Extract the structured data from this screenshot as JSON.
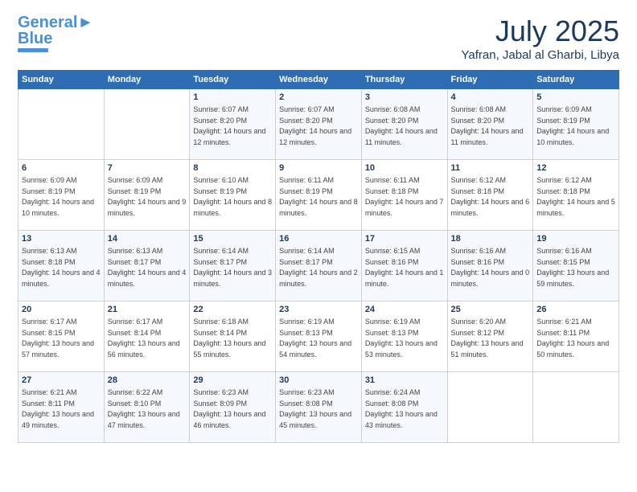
{
  "logo": {
    "line1": "General",
    "line2": "Blue"
  },
  "title": "July 2025",
  "subtitle": "Yafran, Jabal al Gharbi, Libya",
  "days_of_week": [
    "Sunday",
    "Monday",
    "Tuesday",
    "Wednesday",
    "Thursday",
    "Friday",
    "Saturday"
  ],
  "weeks": [
    [
      {
        "num": "",
        "sunrise": "",
        "sunset": "",
        "daylight": ""
      },
      {
        "num": "",
        "sunrise": "",
        "sunset": "",
        "daylight": ""
      },
      {
        "num": "1",
        "sunrise": "Sunrise: 6:07 AM",
        "sunset": "Sunset: 8:20 PM",
        "daylight": "Daylight: 14 hours and 12 minutes."
      },
      {
        "num": "2",
        "sunrise": "Sunrise: 6:07 AM",
        "sunset": "Sunset: 8:20 PM",
        "daylight": "Daylight: 14 hours and 12 minutes."
      },
      {
        "num": "3",
        "sunrise": "Sunrise: 6:08 AM",
        "sunset": "Sunset: 8:20 PM",
        "daylight": "Daylight: 14 hours and 11 minutes."
      },
      {
        "num": "4",
        "sunrise": "Sunrise: 6:08 AM",
        "sunset": "Sunset: 8:20 PM",
        "daylight": "Daylight: 14 hours and 11 minutes."
      },
      {
        "num": "5",
        "sunrise": "Sunrise: 6:09 AM",
        "sunset": "Sunset: 8:19 PM",
        "daylight": "Daylight: 14 hours and 10 minutes."
      }
    ],
    [
      {
        "num": "6",
        "sunrise": "Sunrise: 6:09 AM",
        "sunset": "Sunset: 8:19 PM",
        "daylight": "Daylight: 14 hours and 10 minutes."
      },
      {
        "num": "7",
        "sunrise": "Sunrise: 6:09 AM",
        "sunset": "Sunset: 8:19 PM",
        "daylight": "Daylight: 14 hours and 9 minutes."
      },
      {
        "num": "8",
        "sunrise": "Sunrise: 6:10 AM",
        "sunset": "Sunset: 8:19 PM",
        "daylight": "Daylight: 14 hours and 8 minutes."
      },
      {
        "num": "9",
        "sunrise": "Sunrise: 6:11 AM",
        "sunset": "Sunset: 8:19 PM",
        "daylight": "Daylight: 14 hours and 8 minutes."
      },
      {
        "num": "10",
        "sunrise": "Sunrise: 6:11 AM",
        "sunset": "Sunset: 8:18 PM",
        "daylight": "Daylight: 14 hours and 7 minutes."
      },
      {
        "num": "11",
        "sunrise": "Sunrise: 6:12 AM",
        "sunset": "Sunset: 8:18 PM",
        "daylight": "Daylight: 14 hours and 6 minutes."
      },
      {
        "num": "12",
        "sunrise": "Sunrise: 6:12 AM",
        "sunset": "Sunset: 8:18 PM",
        "daylight": "Daylight: 14 hours and 5 minutes."
      }
    ],
    [
      {
        "num": "13",
        "sunrise": "Sunrise: 6:13 AM",
        "sunset": "Sunset: 8:18 PM",
        "daylight": "Daylight: 14 hours and 4 minutes."
      },
      {
        "num": "14",
        "sunrise": "Sunrise: 6:13 AM",
        "sunset": "Sunset: 8:17 PM",
        "daylight": "Daylight: 14 hours and 4 minutes."
      },
      {
        "num": "15",
        "sunrise": "Sunrise: 6:14 AM",
        "sunset": "Sunset: 8:17 PM",
        "daylight": "Daylight: 14 hours and 3 minutes."
      },
      {
        "num": "16",
        "sunrise": "Sunrise: 6:14 AM",
        "sunset": "Sunset: 8:17 PM",
        "daylight": "Daylight: 14 hours and 2 minutes."
      },
      {
        "num": "17",
        "sunrise": "Sunrise: 6:15 AM",
        "sunset": "Sunset: 8:16 PM",
        "daylight": "Daylight: 14 hours and 1 minute."
      },
      {
        "num": "18",
        "sunrise": "Sunrise: 6:16 AM",
        "sunset": "Sunset: 8:16 PM",
        "daylight": "Daylight: 14 hours and 0 minutes."
      },
      {
        "num": "19",
        "sunrise": "Sunrise: 6:16 AM",
        "sunset": "Sunset: 8:15 PM",
        "daylight": "Daylight: 13 hours and 59 minutes."
      }
    ],
    [
      {
        "num": "20",
        "sunrise": "Sunrise: 6:17 AM",
        "sunset": "Sunset: 8:15 PM",
        "daylight": "Daylight: 13 hours and 57 minutes."
      },
      {
        "num": "21",
        "sunrise": "Sunrise: 6:17 AM",
        "sunset": "Sunset: 8:14 PM",
        "daylight": "Daylight: 13 hours and 56 minutes."
      },
      {
        "num": "22",
        "sunrise": "Sunrise: 6:18 AM",
        "sunset": "Sunset: 8:14 PM",
        "daylight": "Daylight: 13 hours and 55 minutes."
      },
      {
        "num": "23",
        "sunrise": "Sunrise: 6:19 AM",
        "sunset": "Sunset: 8:13 PM",
        "daylight": "Daylight: 13 hours and 54 minutes."
      },
      {
        "num": "24",
        "sunrise": "Sunrise: 6:19 AM",
        "sunset": "Sunset: 8:13 PM",
        "daylight": "Daylight: 13 hours and 53 minutes."
      },
      {
        "num": "25",
        "sunrise": "Sunrise: 6:20 AM",
        "sunset": "Sunset: 8:12 PM",
        "daylight": "Daylight: 13 hours and 51 minutes."
      },
      {
        "num": "26",
        "sunrise": "Sunrise: 6:21 AM",
        "sunset": "Sunset: 8:11 PM",
        "daylight": "Daylight: 13 hours and 50 minutes."
      }
    ],
    [
      {
        "num": "27",
        "sunrise": "Sunrise: 6:21 AM",
        "sunset": "Sunset: 8:11 PM",
        "daylight": "Daylight: 13 hours and 49 minutes."
      },
      {
        "num": "28",
        "sunrise": "Sunrise: 6:22 AM",
        "sunset": "Sunset: 8:10 PM",
        "daylight": "Daylight: 13 hours and 47 minutes."
      },
      {
        "num": "29",
        "sunrise": "Sunrise: 6:23 AM",
        "sunset": "Sunset: 8:09 PM",
        "daylight": "Daylight: 13 hours and 46 minutes."
      },
      {
        "num": "30",
        "sunrise": "Sunrise: 6:23 AM",
        "sunset": "Sunset: 8:08 PM",
        "daylight": "Daylight: 13 hours and 45 minutes."
      },
      {
        "num": "31",
        "sunrise": "Sunrise: 6:24 AM",
        "sunset": "Sunset: 8:08 PM",
        "daylight": "Daylight: 13 hours and 43 minutes."
      },
      {
        "num": "",
        "sunrise": "",
        "sunset": "",
        "daylight": ""
      },
      {
        "num": "",
        "sunrise": "",
        "sunset": "",
        "daylight": ""
      }
    ]
  ]
}
